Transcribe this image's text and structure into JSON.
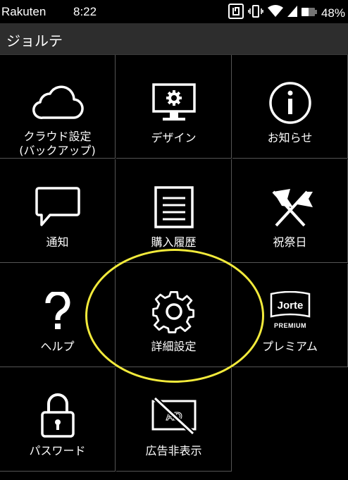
{
  "status_bar": {
    "carrier": "Rakuten",
    "time": "8:22",
    "battery": "48%"
  },
  "app_bar": {
    "title": "ジョルテ"
  },
  "menu": [
    {
      "label": "クラウド設定\n(バックアップ)",
      "icon": "cloud-icon"
    },
    {
      "label": "デザイン",
      "icon": "monitor-gear-icon"
    },
    {
      "label": "お知らせ",
      "icon": "info-icon"
    },
    {
      "label": "通知",
      "icon": "speech-bubble-icon"
    },
    {
      "label": "購入履歴",
      "icon": "document-list-icon"
    },
    {
      "label": "祝祭日",
      "icon": "crossed-flags-icon"
    },
    {
      "label": "ヘルプ",
      "icon": "question-icon"
    },
    {
      "label": "詳細設定",
      "icon": "gear-icon"
    },
    {
      "label": "プレミアム",
      "icon": "jorte-premium-icon"
    },
    {
      "label": "パスワード",
      "icon": "lock-icon"
    },
    {
      "label": "広告非表示",
      "icon": "no-ads-icon"
    }
  ],
  "premium_badge": {
    "brand": "Jorte",
    "text": "PREMIUM"
  },
  "colors": {
    "background": "#000000",
    "appbar": "#2d2d2d",
    "divider": "#555555",
    "highlight": "#f2ea3b"
  }
}
